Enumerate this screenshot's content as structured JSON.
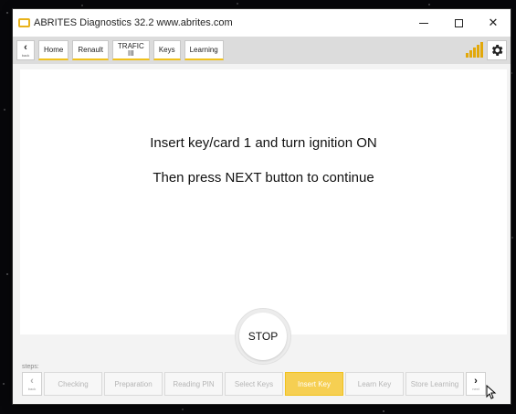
{
  "window": {
    "title": "ABRITES Diagnostics 32.2   www.abrites.com",
    "brand_color": "#e8b21a"
  },
  "toolbar": {
    "back_label": "back",
    "breadcrumbs": [
      "Home",
      "Renault",
      "TRAFIC",
      "III",
      "Keys",
      "Learning"
    ],
    "signal_icon": "signal-strength-icon",
    "settings_icon": "gear-icon"
  },
  "main": {
    "line1": "Insert key/card 1 and turn ignition ON",
    "line2": "Then press NEXT button to continue",
    "stop_label": "STOP"
  },
  "steps": {
    "label": "steps:",
    "prev_label": "back",
    "next_label": "next",
    "items": [
      "Checking",
      "Preparation",
      "Reading PIN",
      "Select Keys",
      "Insert Key",
      "Learn Key",
      "Store Learning"
    ],
    "active_step": "Insert Key",
    "active_color": "#f6cf52"
  }
}
